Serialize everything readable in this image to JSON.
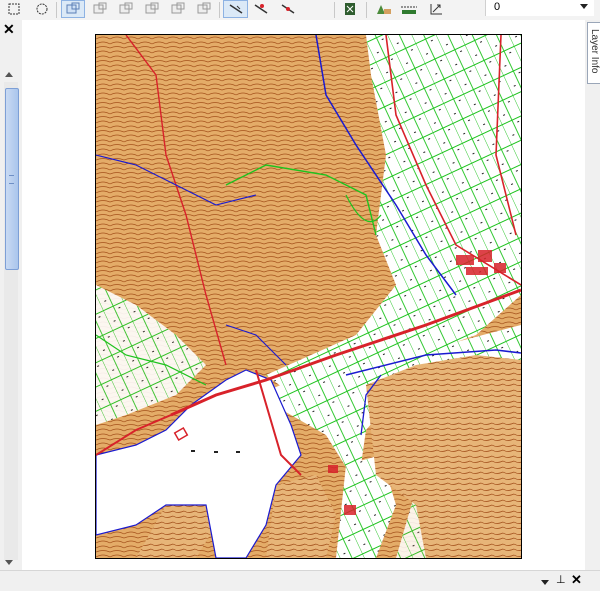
{
  "toolbar": {
    "icons": [
      "rect-select-icon",
      "lasso-select-icon",
      "view-icon-1",
      "view-icon-2",
      "view-icon-3",
      "view-icon-4",
      "view-icon-5",
      "view-icon-6",
      "line-tool-icon",
      "cut-line-icon",
      "split-line-icon",
      "layer-icon",
      "terrain-icon",
      "profile-icon",
      "transform-icon"
    ],
    "zoom_value": "0"
  },
  "left_panel": {
    "close_label": "✕"
  },
  "side_tab": {
    "label": "Layer Info"
  },
  "bottom_bar": {
    "pin_label": "⊥",
    "close_label": "✕"
  },
  "map": {
    "description_colors": {
      "contour": "#b2571c",
      "land": "#e1a866",
      "road": "#d8222a",
      "parcel": "#1ec31e",
      "water": "#1a1ad0"
    }
  }
}
